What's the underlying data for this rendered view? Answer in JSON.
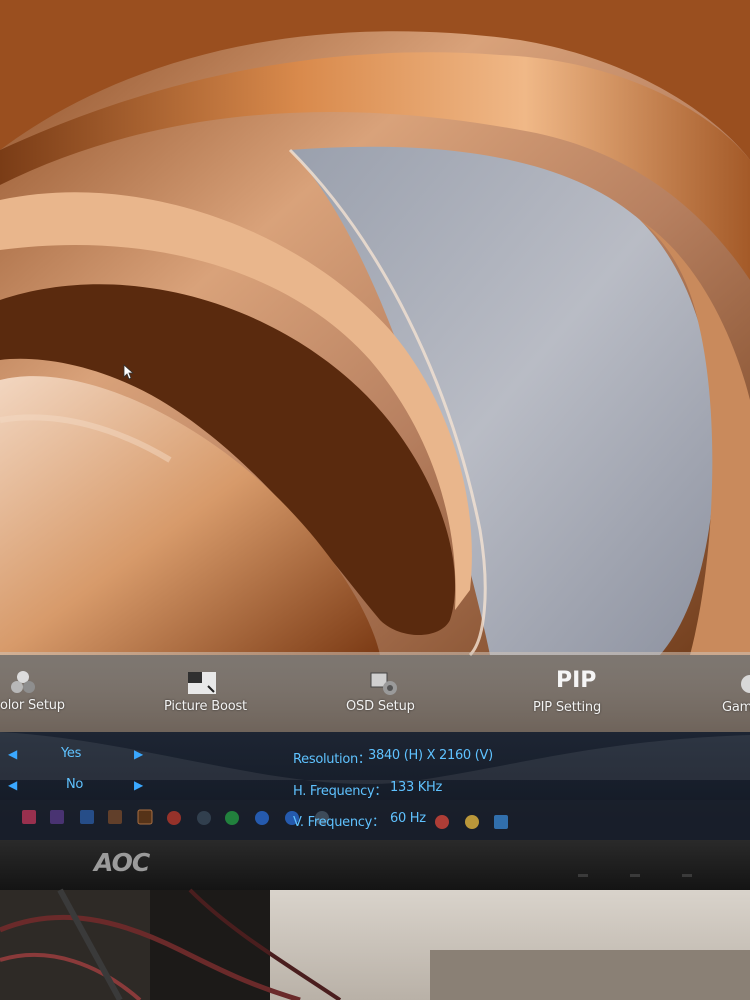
{
  "osd": {
    "tabs": [
      {
        "label": "olor Setup",
        "icon": "color-setup-icon"
      },
      {
        "label": "Picture Boost",
        "icon": "picture-boost-icon"
      },
      {
        "label": "OSD Setup",
        "icon": "osd-setup-icon"
      },
      {
        "label": "PIP Setting",
        "icon": "pip-icon",
        "icon_text": "PIP"
      },
      {
        "label": "Gam",
        "icon": "game-icon"
      }
    ],
    "options": [
      {
        "value": "Yes"
      },
      {
        "value": "No"
      }
    ],
    "info": [
      {
        "label": "Resolution：",
        "value": "3840 (H) X 2160 (V)"
      },
      {
        "label": "H. Frequency：",
        "value": "133 KHz"
      },
      {
        "label": "V. Frequency：",
        "value": "60 Hz"
      }
    ],
    "accent_color": "#5fc2ff"
  },
  "monitor": {
    "brand": "AOC"
  }
}
